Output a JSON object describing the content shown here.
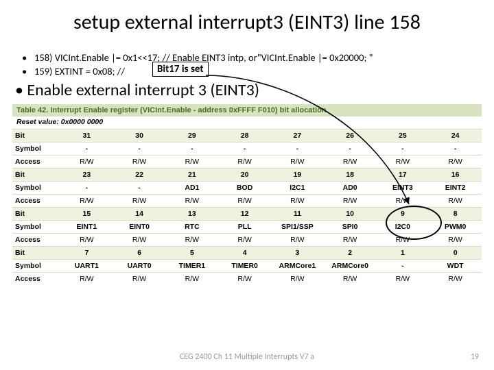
{
  "title": "setup external interrupt3 (EINT3) line 158",
  "callout": "Bit17 is set",
  "code": {
    "line158": "158)    VICInt.Enable |=  0x1<<17; // Enable EINT3 intp, or\"VICInt.Enable |= 0x20000; \"",
    "line159": "159)    EXTINT = 0x08;                                                  //"
  },
  "enable_text": "Enable external interrupt 3 (EINT3)",
  "table": {
    "caption": "Table 42.   Interrupt Enable register (VICInt.Enable - address 0xFFFF F010) bit allocation",
    "reset": "Reset value: 0x0000 0000",
    "groups": [
      {
        "bits": [
          "31",
          "30",
          "29",
          "28",
          "27",
          "26",
          "25",
          "24"
        ],
        "symbol": [
          "-",
          "-",
          "-",
          "-",
          "-",
          "-",
          "-",
          "-"
        ],
        "access": [
          "R/W",
          "R/W",
          "R/W",
          "R/W",
          "R/W",
          "R/W",
          "R/W",
          "R/W"
        ]
      },
      {
        "bits": [
          "23",
          "22",
          "21",
          "20",
          "19",
          "18",
          "17",
          "16"
        ],
        "symbol": [
          "-",
          "-",
          "AD1",
          "BOD",
          "I2C1",
          "AD0",
          "EINT3",
          "EINT2"
        ],
        "access": [
          "R/W",
          "R/W",
          "R/W",
          "R/W",
          "R/W",
          "R/W",
          "R/W",
          "R/W"
        ]
      },
      {
        "bits": [
          "15",
          "14",
          "13",
          "12",
          "11",
          "10",
          "9",
          "8"
        ],
        "symbol": [
          "EINT1",
          "EINT0",
          "RTC",
          "PLL",
          "SPI1/SSP",
          "SPI0",
          "I2C0",
          "PWM0"
        ],
        "access": [
          "R/W",
          "R/W",
          "R/W",
          "R/W",
          "R/W",
          "R/W",
          "R/W",
          "R/W"
        ]
      },
      {
        "bits": [
          "7",
          "6",
          "5",
          "4",
          "3",
          "2",
          "1",
          "0"
        ],
        "symbol": [
          "UART1",
          "UART0",
          "TIMER1",
          "TIMER0",
          "ARMCore1",
          "ARMCore0",
          "-",
          "WDT"
        ],
        "access": [
          "R/W",
          "R/W",
          "R/W",
          "R/W",
          "R/W",
          "R/W",
          "R/W",
          "R/W"
        ]
      }
    ],
    "row_labels": {
      "bit": "Bit",
      "symbol": "Symbol",
      "access": "Access"
    }
  },
  "footer": "CEG 2400 Ch 11 Multiple Interrupts V7 a",
  "page": "19",
  "chart_data": {
    "type": "table",
    "title": "Interrupt Enable register (VICInt.Enable - address 0xFFFF F010) bit allocation",
    "columns": [
      "Bit",
      "Symbol",
      "Access"
    ],
    "rows": [
      [
        31,
        "-",
        "R/W"
      ],
      [
        30,
        "-",
        "R/W"
      ],
      [
        29,
        "-",
        "R/W"
      ],
      [
        28,
        "-",
        "R/W"
      ],
      [
        27,
        "-",
        "R/W"
      ],
      [
        26,
        "-",
        "R/W"
      ],
      [
        25,
        "-",
        "R/W"
      ],
      [
        24,
        "-",
        "R/W"
      ],
      [
        23,
        "-",
        "R/W"
      ],
      [
        22,
        "-",
        "R/W"
      ],
      [
        21,
        "AD1",
        "R/W"
      ],
      [
        20,
        "BOD",
        "R/W"
      ],
      [
        19,
        "I2C1",
        "R/W"
      ],
      [
        18,
        "AD0",
        "R/W"
      ],
      [
        17,
        "EINT3",
        "R/W"
      ],
      [
        16,
        "EINT2",
        "R/W"
      ],
      [
        15,
        "EINT1",
        "R/W"
      ],
      [
        14,
        "EINT0",
        "R/W"
      ],
      [
        13,
        "RTC",
        "R/W"
      ],
      [
        12,
        "PLL",
        "R/W"
      ],
      [
        11,
        "SPI1/SSP",
        "R/W"
      ],
      [
        10,
        "SPI0",
        "R/W"
      ],
      [
        9,
        "I2C0",
        "R/W"
      ],
      [
        8,
        "PWM0",
        "R/W"
      ],
      [
        7,
        "UART1",
        "R/W"
      ],
      [
        6,
        "UART0",
        "R/W"
      ],
      [
        5,
        "TIMER1",
        "R/W"
      ],
      [
        4,
        "TIMER0",
        "R/W"
      ],
      [
        3,
        "ARMCore1",
        "R/W"
      ],
      [
        2,
        "ARMCore0",
        "R/W"
      ],
      [
        1,
        "-",
        "R/W"
      ],
      [
        0,
        "WDT",
        "R/W"
      ]
    ],
    "highlight_bit": 17,
    "reset_value": "0x0000 0000"
  }
}
